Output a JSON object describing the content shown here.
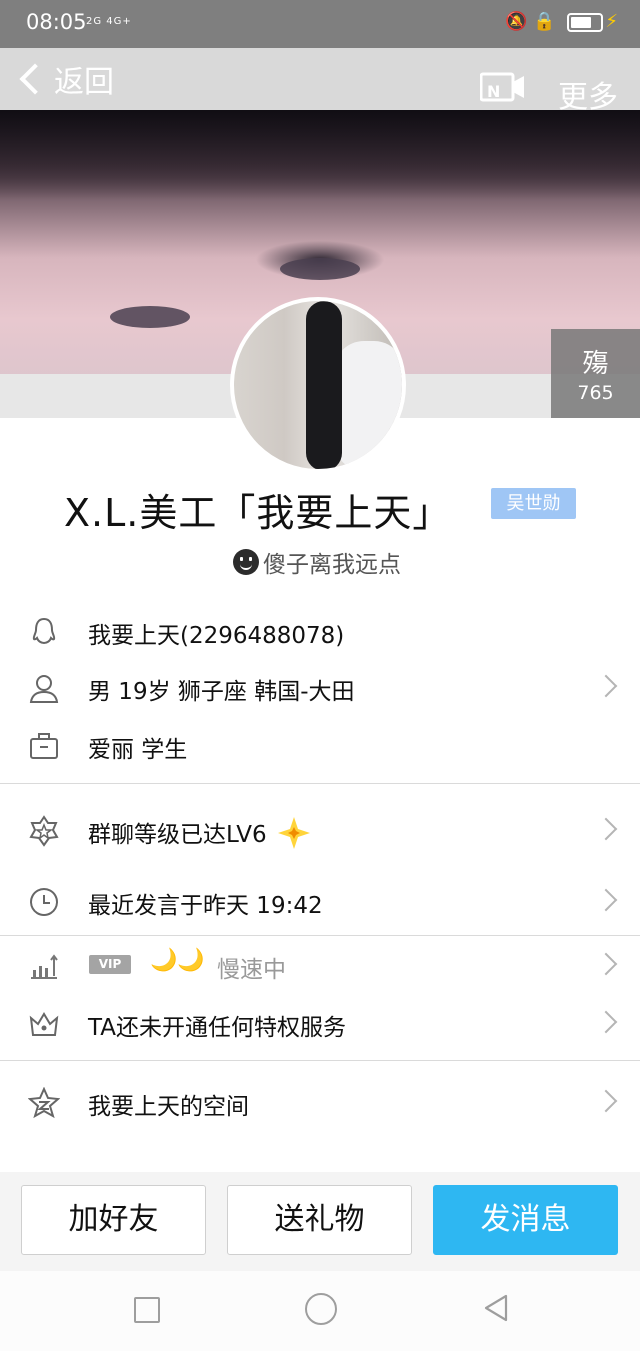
{
  "status_bar": {
    "time": "08:05",
    "signal": "2G 4G+",
    "icons": [
      "mute-bell-icon",
      "lock-rotation-icon",
      "battery-icon",
      "charging-icon"
    ]
  },
  "nav": {
    "back_label": "返回",
    "more_label": "更多",
    "video_icon": "video-call-icon"
  },
  "cover": {
    "badge_glyph": "殤",
    "badge_count": "765"
  },
  "profile": {
    "name": "X.L.美工「我要上天」",
    "tag": "吴世勋",
    "signature": "傻子离我远点"
  },
  "info_rows": [
    {
      "icon": "qq-penguin-icon",
      "text": "我要上天(2296488078)"
    },
    {
      "icon": "person-icon",
      "text": "男  19岁  狮子座  韩国-大田"
    },
    {
      "icon": "briefcase-icon",
      "text": "爱丽 学生"
    }
  ],
  "group_rows": [
    {
      "icon": "badge-star-icon",
      "text": "群聊等级已达LV6"
    },
    {
      "icon": "clock-icon",
      "text": "最近发言于昨天 19:42"
    }
  ],
  "vip_row": {
    "icon": "growth-chart-icon",
    "badge": "VIP",
    "moons": "🌙🌙",
    "status": "慢速中"
  },
  "privilege_row": {
    "icon": "crown-icon",
    "text": "TA还未开通任何特权服务"
  },
  "space_row": {
    "icon": "qzone-star-icon",
    "text": "我要上天的空间"
  },
  "actions": {
    "add_friend": "加好友",
    "send_gift": "送礼物",
    "send_message": "发消息"
  },
  "colors": {
    "accent": "#2eb7f2",
    "tag_bg": "#9fc6f5",
    "divider": "#dadada"
  }
}
